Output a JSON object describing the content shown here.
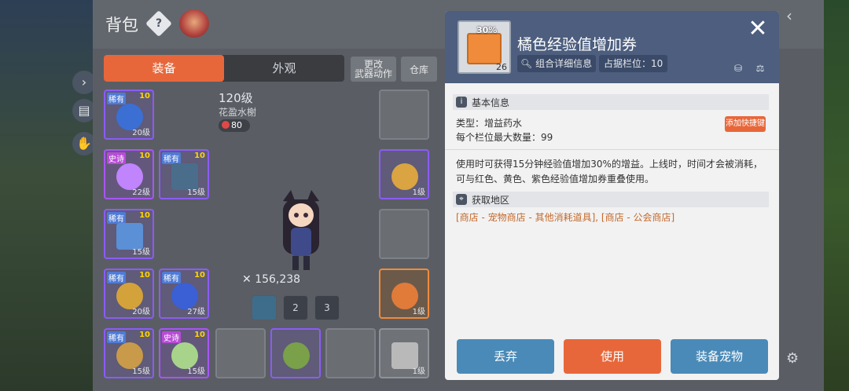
{
  "bag": {
    "title": "背包",
    "tabs": [
      "装备",
      "外观"
    ],
    "buttons": {
      "change_weapon": "更改\n武器动作",
      "warehouse": "仓库"
    },
    "character": {
      "level": "120级",
      "name": "花盈水榭",
      "power": "80",
      "coins": "156,238"
    },
    "skills": [
      "",
      "2",
      "3"
    ]
  },
  "slots": [
    {
      "badge": "稀有",
      "badge_type": "r",
      "star": "10",
      "lvl": "20级",
      "color": "#3b6fd4"
    },
    {
      "badge": "史诗",
      "badge_type": "e",
      "star": "10",
      "lvl": "22级",
      "color": "#c084fc"
    },
    {
      "badge": "稀有",
      "badge_type": "r",
      "star": "10",
      "lvl": "15级",
      "color": "#4a6d8c"
    },
    {
      "badge": "稀有",
      "badge_type": "r",
      "star": "10",
      "lvl": "15级",
      "color": "#5b8fd6"
    },
    {
      "badge": "稀有",
      "badge_type": "r",
      "star": "10",
      "lvl": "20级",
      "color": "#d4a23b"
    },
    {
      "badge": "稀有",
      "badge_type": "r",
      "star": "10",
      "lvl": "27级",
      "color": "#3b5fd4"
    },
    {
      "badge": "稀有",
      "badge_type": "r",
      "star": "10",
      "lvl": "15级",
      "color": "#c89a4a"
    },
    {
      "badge": "史诗",
      "badge_type": "e",
      "star": "10",
      "lvl": "15级",
      "color": "#a7d48a"
    },
    {
      "badge": "",
      "badge_type": "",
      "star": "",
      "lvl": "1级",
      "color": "#d9a441"
    },
    {
      "badge": "",
      "badge_type": "",
      "star": "",
      "lvl": "1级",
      "color": "#e07b3a"
    },
    {
      "badge": "",
      "badge_type": "",
      "star": "",
      "lvl": "1级",
      "color": "#b9b9b9"
    }
  ],
  "item_panel": {
    "title": "橘色经验值增加券",
    "icon_text": "30%",
    "quantity": "26",
    "detail_button": "组合详细信息",
    "slot_info": "占据栏位：10",
    "basic_info_label": "基本信息",
    "type": "类型：增益药水",
    "max_per_slot": "每个栏位最大数量：99",
    "quick_slot_button": "添加快捷键",
    "description": "使用时可获得15分钟经验值增加30%的增益。上线时，时间才会被消耗，可与红色、黄色、紫色经验值增加券重叠使用。",
    "obtain_label": "获取地区",
    "obtain_text": "[商店 - 宠物商店 - 其他消耗道具], [商店 - 公会商店]",
    "actions": {
      "discard": "丢弃",
      "use": "使用",
      "equip_pet": "装备宠物"
    }
  },
  "colors": {
    "accent_orange": "#e8673a",
    "button_blue": "#4a8ab8",
    "header_blue": "#4d5e7e",
    "location_text": "#c4692c"
  }
}
